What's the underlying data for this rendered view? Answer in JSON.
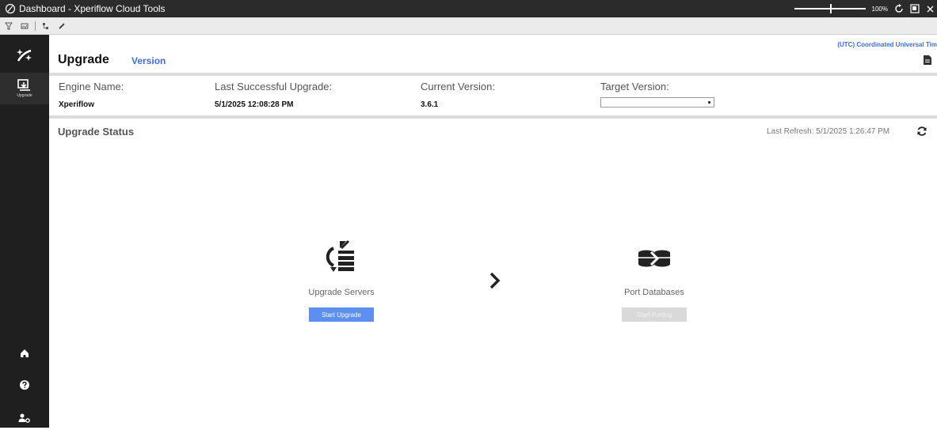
{
  "window": {
    "title": "Dashboard - Xperiflow Cloud Tools",
    "zoom": "100%",
    "zoom_level": 1.0
  },
  "sidebar": {
    "items": [
      {
        "name": "logo",
        "label": ""
      },
      {
        "name": "upgrade",
        "label": "Upgrade"
      }
    ],
    "bottom": [
      "home-icon",
      "help-icon",
      "user-settings-icon"
    ]
  },
  "header": {
    "timezone": "(UTC) Coordinated Universal Tim",
    "title": "Upgrade",
    "version_link": "Version"
  },
  "engine": {
    "name_label": "Engine Name:",
    "name_value": "Xperiflow",
    "last_upgrade_label": "Last Successful Upgrade:",
    "last_upgrade_value": "5/1/2025 12:08:28 PM",
    "current_version_label": "Current Version:",
    "current_version_value": "3.6.1",
    "target_version_label": "Target Version:",
    "target_version_value": ""
  },
  "status": {
    "title": "Upgrade Status",
    "last_refresh": "Last Refresh: 5/1/2025 1:26:47 PM"
  },
  "steps": {
    "upgrade_servers": {
      "label": "Upgrade Servers",
      "button": "Start Upgrade"
    },
    "port_databases": {
      "label": "Port Databases",
      "button": "Start Porting"
    }
  },
  "colors": {
    "accent": "#5b8ff0",
    "link": "#3a6fd8",
    "sidebar_bg": "#1f1f1f",
    "titlebar_bg": "#2b2b2b"
  }
}
